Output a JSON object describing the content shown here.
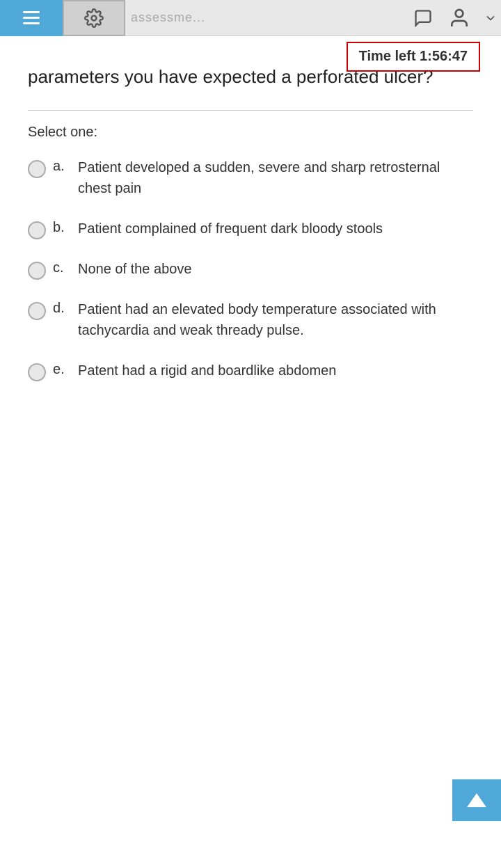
{
  "header": {
    "title": "assessme...",
    "settings_label": "settings",
    "menu_label": "menu"
  },
  "timer": {
    "label": "Time left 1:56:47"
  },
  "question": {
    "text": "parameters you have expected a perforated ulcer?"
  },
  "select_label": "Select one:",
  "options": [
    {
      "letter": "a.",
      "text": "Patient developed a sudden, severe and sharp retrosternal chest pain"
    },
    {
      "letter": "b.",
      "text": "Patient complained of frequent dark bloody stools"
    },
    {
      "letter": "c.",
      "text": "None of the above"
    },
    {
      "letter": "d.",
      "text": "Patient had an elevated body temperature associated with tachycardia and weak thready pulse."
    },
    {
      "letter": "e.",
      "text": "Patent had a rigid and boardlike abdomen"
    }
  ],
  "scroll_top_label": "scroll to top"
}
